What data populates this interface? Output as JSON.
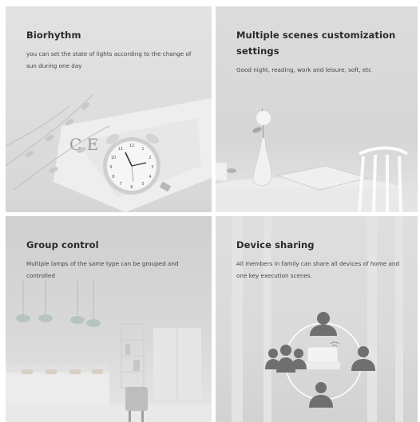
{
  "cards": [
    {
      "title": "Biorhythm",
      "description": "you can set the state of lights according to the change of sun during one day"
    },
    {
      "title": "Multiple scenes customization settings",
      "description": "Good night, reading, work and leisure, soft, etc"
    },
    {
      "title": "Group control",
      "description": "Multiple lamps of the same type can be grouped and controlled"
    },
    {
      "title": "Device sharing",
      "description": "All members in family can share all devices of home and one key execution scenes."
    }
  ],
  "colors": {
    "title": "#2a2a2a",
    "text": "#444444",
    "icon": "#6f6f6f"
  }
}
